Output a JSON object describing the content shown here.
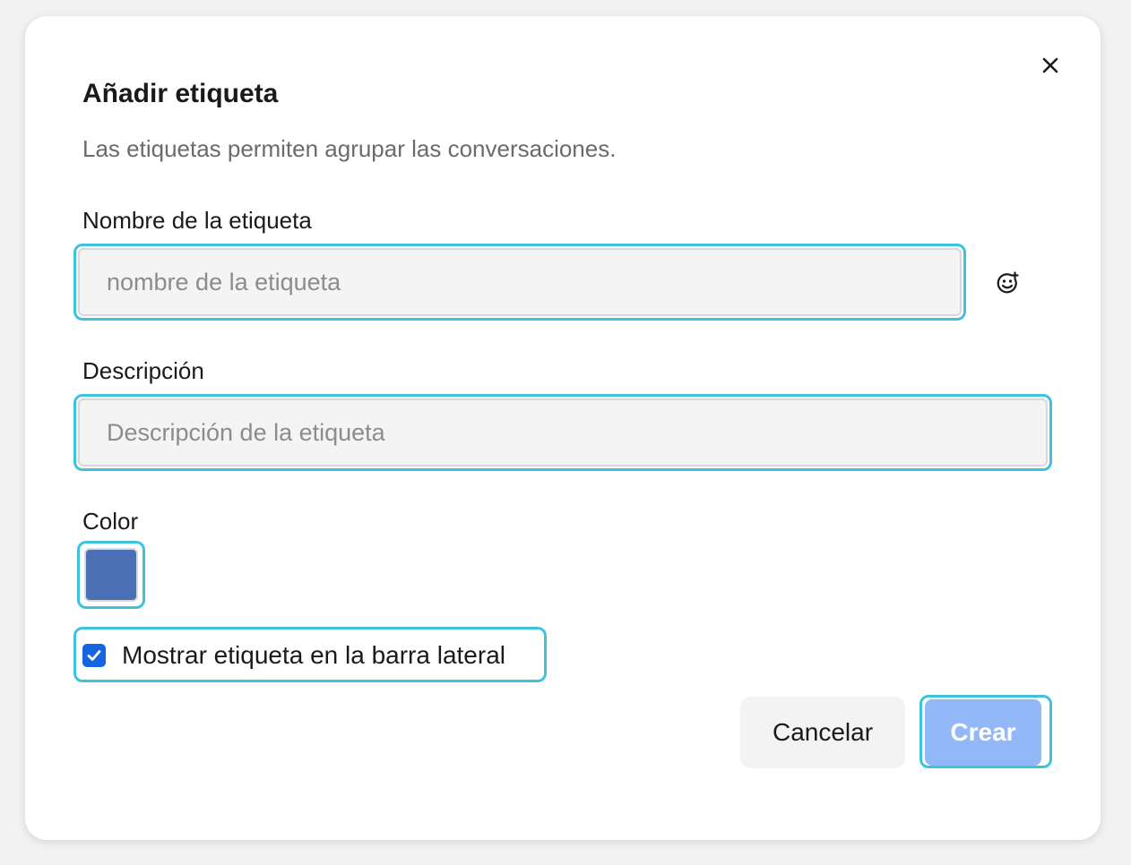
{
  "dialog": {
    "title": "Añadir etiqueta",
    "subtitle": "Las etiquetas permiten agrupar las conversaciones.",
    "close_icon": "close-icon"
  },
  "name_field": {
    "label": "Nombre de la etiqueta",
    "value": "",
    "placeholder": "nombre de la etiqueta",
    "emoji_icon": "emoji-add-icon"
  },
  "description_field": {
    "label": "Descripción",
    "value": "",
    "placeholder": "Descripción de la etiqueta"
  },
  "color_field": {
    "label": "Color",
    "selected_color": "#4a6fb5"
  },
  "sidebar_option": {
    "label": "Mostrar etiqueta en la barra lateral",
    "checked": true
  },
  "actions": {
    "cancel_label": "Cancelar",
    "create_label": "Crear",
    "create_color": "#93b8f8"
  },
  "colors": {
    "focus_ring": "#3ec3dd",
    "checkbox": "#1565e0"
  }
}
